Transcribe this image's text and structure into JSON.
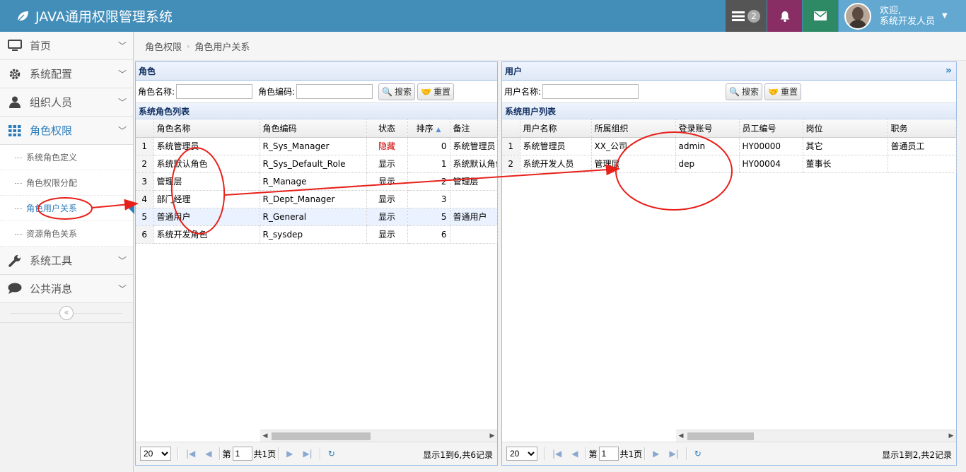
{
  "app": {
    "title": "JAVA通用权限管理系统"
  },
  "header": {
    "tasks_badge": "2",
    "welcome": "欢迎,",
    "user_name": "系统开发人员"
  },
  "sidebar": {
    "items": [
      {
        "label": "首页"
      },
      {
        "label": "系统配置"
      },
      {
        "label": "组织人员"
      },
      {
        "label": "角色权限"
      },
      {
        "label": "系统工具"
      },
      {
        "label": "公共消息"
      }
    ],
    "sub_items": [
      {
        "label": "系统角色定义"
      },
      {
        "label": "角色权限分配"
      },
      {
        "label": "角色用户关系"
      },
      {
        "label": "资源角色关系"
      }
    ],
    "collapse": "«"
  },
  "breadcrumb": {
    "items": [
      "角色权限",
      "角色用户关系"
    ]
  },
  "role_panel": {
    "title": "角色",
    "search": {
      "name_label": "角色名称:",
      "code_label": "角色编码:",
      "search_btn": "搜索",
      "reset_btn": "重置"
    },
    "grid_title": "系统角色列表",
    "columns": [
      "角色名称",
      "角色编码",
      "状态",
      "排序",
      "备注"
    ],
    "rows": [
      {
        "n": "1",
        "name": "系统管理员",
        "code": "R_Sys_Manager",
        "status": "隐藏",
        "order": "0",
        "note": "系统管理员"
      },
      {
        "n": "2",
        "name": "系统默认角色",
        "code": "R_Sys_Default_Role",
        "status": "显示",
        "order": "1",
        "note": "系统默认角色"
      },
      {
        "n": "3",
        "name": "管理层",
        "code": "R_Manage",
        "status": "显示",
        "order": "2",
        "note": "管理层"
      },
      {
        "n": "4",
        "name": "部门经理",
        "code": "R_Dept_Manager",
        "status": "显示",
        "order": "3",
        "note": ""
      },
      {
        "n": "5",
        "name": "普通用户",
        "code": "R_General",
        "status": "显示",
        "order": "5",
        "note": "普通用户"
      },
      {
        "n": "6",
        "name": "系统开发角色",
        "code": "R_sysdep",
        "status": "显示",
        "order": "6",
        "note": ""
      }
    ],
    "pager": {
      "page_size": "20",
      "page_prefix": "第",
      "page": "1",
      "page_suffix": "共1页",
      "info": "显示1到6,共6记录"
    }
  },
  "user_panel": {
    "title": "用户",
    "collapse_icon": "»",
    "search": {
      "name_label": "用户名称:",
      "search_btn": "搜索",
      "reset_btn": "重置"
    },
    "grid_title": "系统用户列表",
    "columns": [
      "用户名称",
      "所属组织",
      "登录账号",
      "员工编号",
      "岗位",
      "职务"
    ],
    "rows": [
      {
        "n": "1",
        "name": "系统管理员",
        "org": "XX_公司",
        "account": "admin",
        "emp_no": "HY00000",
        "post": "其它",
        "duty": "普通员工"
      },
      {
        "n": "2",
        "name": "系统开发人员",
        "org": "管理层",
        "account": "dep",
        "emp_no": "HY00004",
        "post": "董事长",
        "duty": ""
      }
    ],
    "pager": {
      "page_size": "20",
      "page_prefix": "第",
      "page": "1",
      "page_suffix": "共1页",
      "info": "显示1到2,共2记录"
    }
  },
  "colors": {
    "header": "#438eb9",
    "accent": "#2b7dbc",
    "annotation": "#e8201a"
  }
}
